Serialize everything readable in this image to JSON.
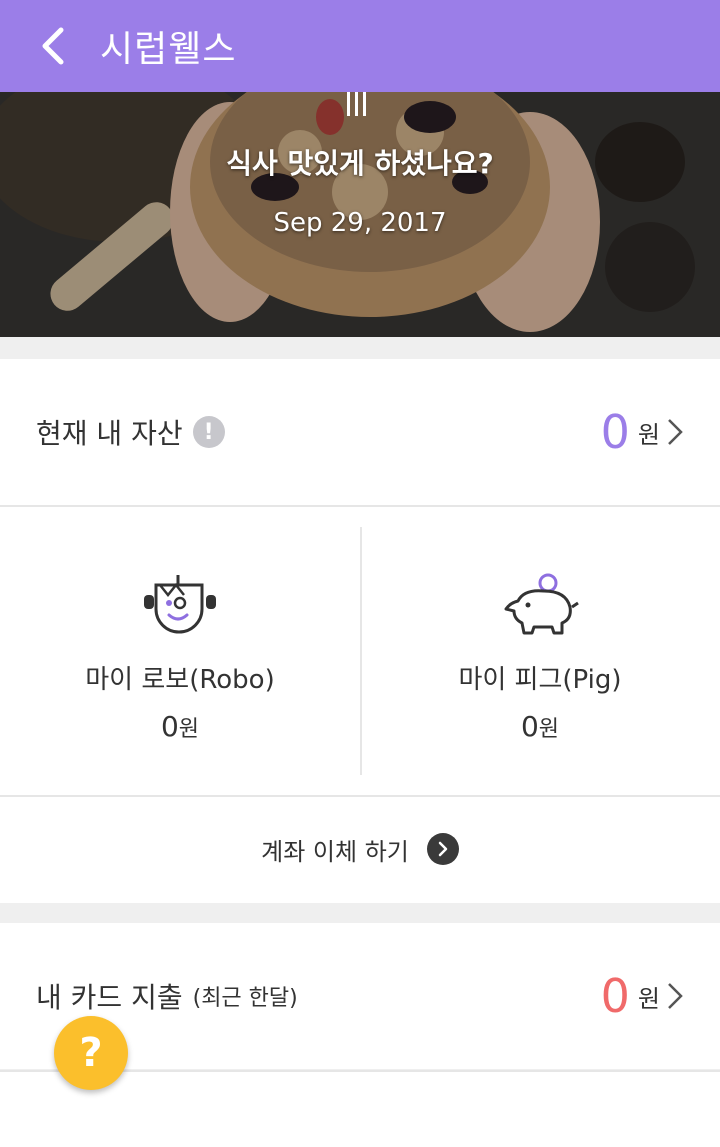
{
  "header": {
    "title": "시럽웰스"
  },
  "banner": {
    "greeting": "식사 맛있게 하셨나요?",
    "date": "Sep  29,  2017"
  },
  "assets": {
    "label": "현재 내 자산",
    "amount": "0",
    "unit": "원"
  },
  "robo": {
    "label": "마이 로보(Robo)",
    "amount": "0",
    "unit": "원"
  },
  "pig": {
    "label": "마이 피그(Pig)",
    "amount": "0",
    "unit": "원"
  },
  "transfer": {
    "label": "계좌 이체 하기"
  },
  "spending": {
    "label": "내 카드 지출",
    "sub": "(최근 한달)",
    "amount": "0",
    "unit": "원"
  },
  "help": {
    "symbol": "?"
  },
  "colors": {
    "header": "#9b7ee8",
    "asset_amount": "#9b7ee8",
    "spending_amount": "#f06a6a",
    "help": "#fbbf2c"
  },
  "icons": {
    "back": "chevron-left-icon",
    "info": "info-icon",
    "robo": "robot-face-icon",
    "pig": "piggy-bank-icon",
    "transfer": "arrow-circle-icon",
    "help": "help-icon"
  }
}
